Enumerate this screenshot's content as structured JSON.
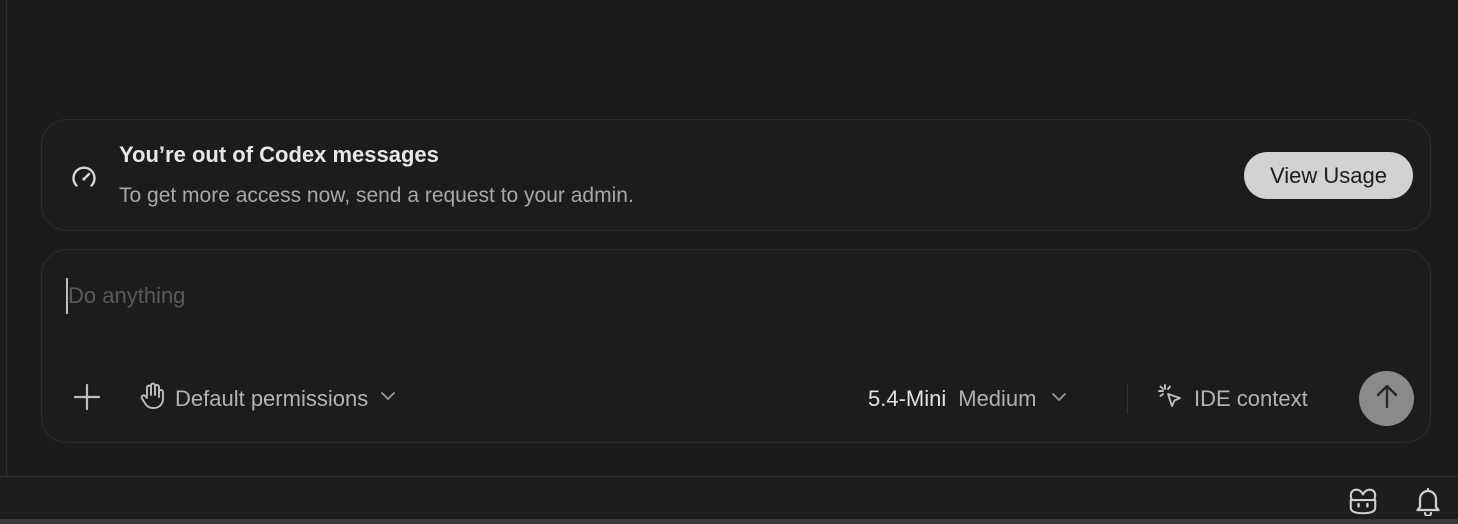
{
  "banner": {
    "icon": "gauge-icon",
    "title": "You’re out of Codex messages",
    "subtitle": "To get more access now, send a request to your admin.",
    "button_label": "View Usage"
  },
  "composer": {
    "placeholder": "Do anything",
    "value": "",
    "add_icon": "plus-icon",
    "permissions": {
      "icon": "hand-icon",
      "label": "Default permissions"
    },
    "model": {
      "name": "5.4-Mini",
      "effort": "Medium"
    },
    "ide_context": {
      "icon": "cursor-click-icon",
      "label": "IDE context"
    },
    "send_icon": "arrow-up-icon"
  },
  "statusbar": {
    "icons": [
      "copilot-icon",
      "bell-icon"
    ]
  },
  "colors": {
    "background": "#1b1b1d",
    "button_bg": "#d2d2d2",
    "send_bg": "#8a8a8c",
    "muted_text": "#a8a8a8"
  }
}
